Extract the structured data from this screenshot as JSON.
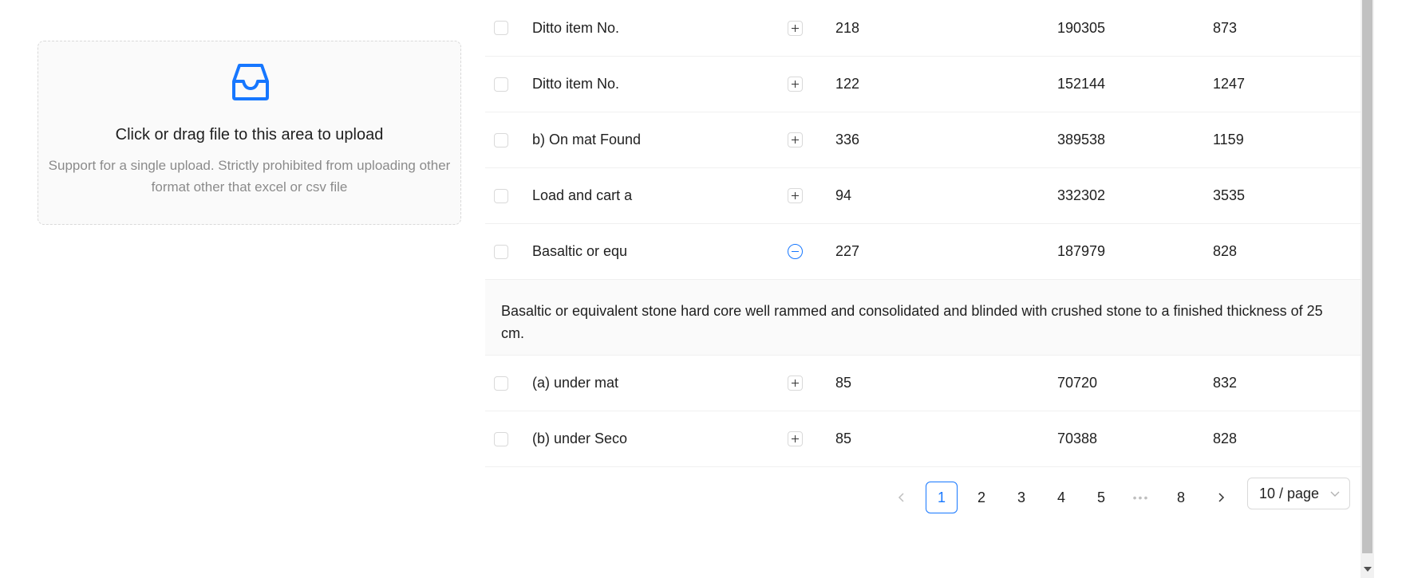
{
  "upload": {
    "icon": "inbox-icon",
    "title": "Click or drag file to this area to upload",
    "hint": "Support for a single upload. Strictly prohibited from uploading other format other that excel or csv file",
    "accent_color": "#1677ff"
  },
  "table": {
    "rows": [
      {
        "name": "Ditto item No.",
        "a": "218",
        "b": "190305",
        "c": "873",
        "expanded": false
      },
      {
        "name": "Ditto item No.",
        "a": "122",
        "b": "152144",
        "c": "1247",
        "expanded": false
      },
      {
        "name": "b) On mat Found",
        "a": "336",
        "b": "389538",
        "c": "1159",
        "expanded": false
      },
      {
        "name": "Load and cart a",
        "a": "94",
        "b": "332302",
        "c": "3535",
        "expanded": false
      },
      {
        "name": "Basaltic or equ",
        "a": "227",
        "b": "187979",
        "c": "828",
        "expanded": true
      },
      {
        "name": "(a) under mat",
        "a": "85",
        "b": "70720",
        "c": "832",
        "expanded": false
      },
      {
        "name": "(b) under Seco",
        "a": "85",
        "b": "70388",
        "c": "828",
        "expanded": false
      }
    ],
    "expanded_description": "Basaltic or equivalent stone hard core well rammed and consolidated and blinded with crushed stone to a finished thickness of 25 cm."
  },
  "pagination": {
    "prev_icon": "chevron-left-icon",
    "next_icon": "chevron-right-icon",
    "pages": [
      "1",
      "2",
      "3",
      "4",
      "5"
    ],
    "ellipsis": "•••",
    "last_page": "8",
    "current_page": "1",
    "page_size": "10 / page"
  }
}
